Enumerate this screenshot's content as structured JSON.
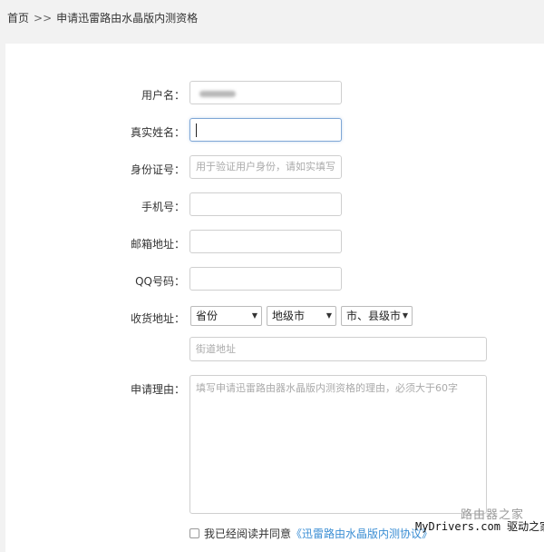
{
  "breadcrumb": {
    "home": "首页",
    "separator": ">>",
    "current": "申请迅雷路由水晶版内测资格"
  },
  "form": {
    "username": {
      "label": "用户名：",
      "value": ""
    },
    "realname": {
      "label": "真实姓名：",
      "value": ""
    },
    "idcard": {
      "label": "身份证号：",
      "placeholder": "用于验证用户身份，请如实填写"
    },
    "phone": {
      "label": "手机号：",
      "value": ""
    },
    "email": {
      "label": "邮箱地址：",
      "value": ""
    },
    "qq": {
      "label": "QQ号码：",
      "value": ""
    },
    "address": {
      "label": "收货地址：",
      "province": "省份",
      "city": "地级市",
      "county": "市、县级市",
      "street_placeholder": "街道地址"
    },
    "reason": {
      "label": "申请理由：",
      "placeholder": "填写申请迅雷路由器水晶版内测资格的理由，必须大于60字"
    },
    "agreement": {
      "prefix": "我已经阅读并同意",
      "link": "《迅雷路由水晶版内测协议》"
    }
  },
  "watermark": {
    "line1": "路由器之家",
    "line2": "MyDrivers.com 驱动之家"
  }
}
